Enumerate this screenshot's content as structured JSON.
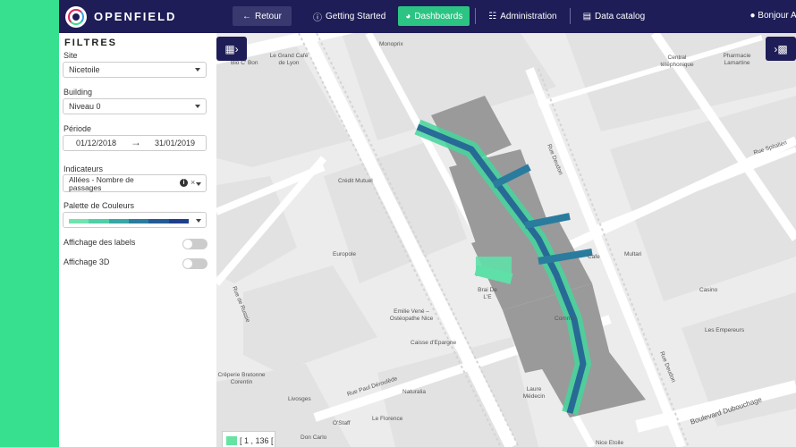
{
  "brand": {
    "name": "OPENFIELD"
  },
  "nav": {
    "back": "Retour",
    "getting_started": "Getting Started",
    "dashboards": "Dashboards",
    "administration": "Administration",
    "data_catalog": "Data catalog",
    "user": "Bonjour Ar"
  },
  "filters": {
    "title": "FILTRES",
    "site_label": "Site",
    "site_value": "Nicetoile",
    "building_label": "Building",
    "building_value": "Niveau 0",
    "period_label": "Période",
    "period_start": "01/12/2018",
    "period_end": "31/01/2019",
    "indicators_label": "Indicateurs",
    "indicators_value": "Allées - Nombre de passages",
    "palette_label": "Palette de Couleurs",
    "palette_colors": [
      "#6fe3b0",
      "#4fcfa8",
      "#36a7a6",
      "#2a7c9e",
      "#235a95",
      "#1e3f8c"
    ],
    "labels_toggle": "Affichage des labels",
    "labels_on": false,
    "view3d_toggle": "Affichage 3D",
    "view3d_on": false
  },
  "map": {
    "legend": "[ 1 , 136 [",
    "legend_color": "#66e3a3",
    "labels": [
      "Monoprix",
      "Le Grand Café de Lyon",
      "Bio C' Bon",
      "Central téléphonique",
      "Pharmacie Lamartine",
      "Rue Spitalieri",
      "Crédit Mutuel",
      "Rue Deudon",
      "Europole",
      "Multari",
      "Casino",
      "Rue de Russie",
      "Emilie Vené – Ostéopathe Nice",
      "Caisse d'Epargne",
      "Les Empereurs",
      "Crêperie Bretonne Corentin",
      "Rue Paul Déroulède",
      "Naturalia",
      "Livosges",
      "O'Staff",
      "Le Florence",
      "Don Carlo",
      "Boulevard Dubouchage",
      "Nice Etoile",
      "Laure Médecin",
      "Brai De L'E",
      "Commo",
      "Cafe",
      "Rue Deudon"
    ]
  },
  "colors": {
    "accent": "#36e08f",
    "nav_bg": "#1e1d57",
    "active": "#2cc483"
  }
}
